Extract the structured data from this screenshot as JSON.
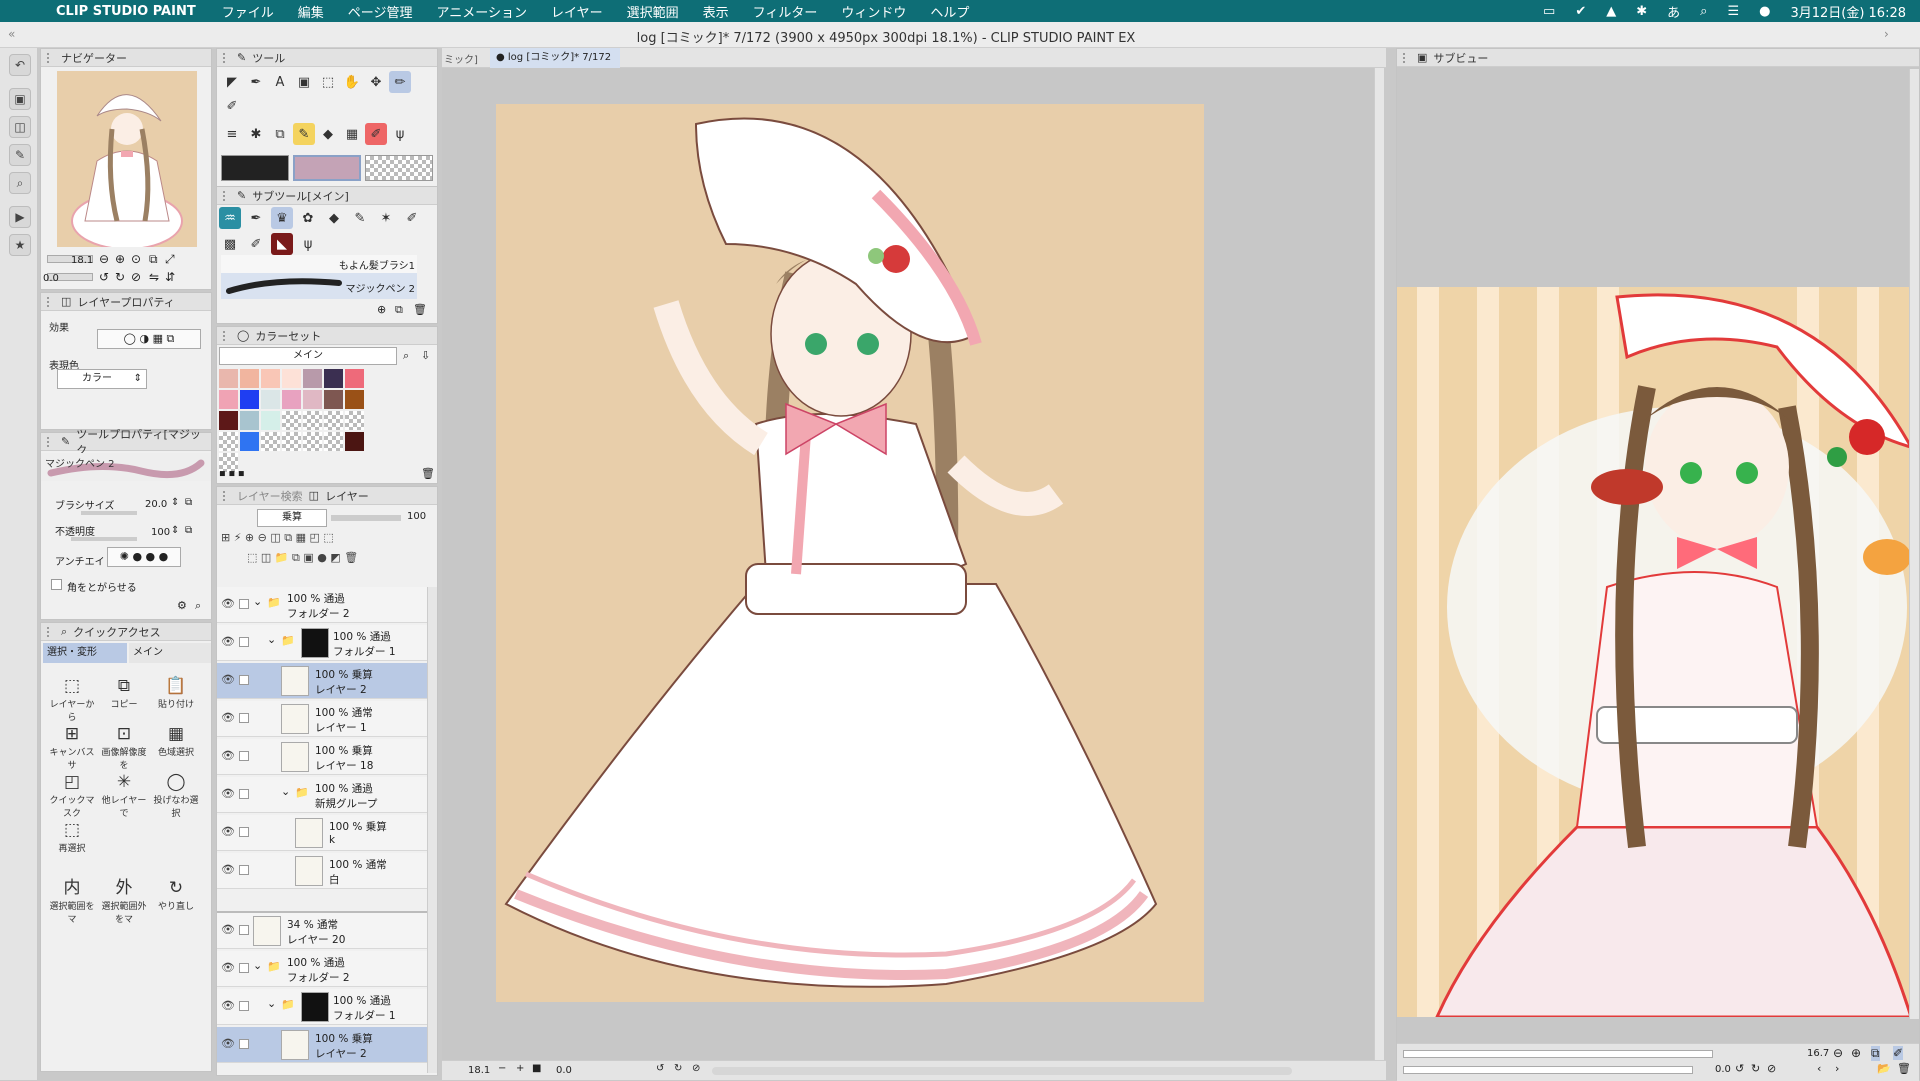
{
  "menubar": {
    "apple": "",
    "app_name": "CLIP STUDIO PAINT",
    "items": [
      "ファイル",
      "編集",
      "ページ管理",
      "アニメーション",
      "レイヤー",
      "選択範囲",
      "表示",
      "フィルター",
      "ウィンドウ",
      "ヘルプ"
    ],
    "datetime": "3月12日(金)  16:28"
  },
  "window": {
    "title": "log [コミック]* 7/172 (3900 x 4950px 300dpi 18.1%)  - CLIP STUDIO PAINT EX",
    "tab_prev": "ミック]",
    "tab_active": "● log [コミック]* 7/172"
  },
  "navigator": {
    "header": "ナビゲーター",
    "zoom": "18.1",
    "angle": "0.0"
  },
  "layer_property": {
    "header": "レイヤープロパティ",
    "effect_label": "効果",
    "expression_color_label": "表現色",
    "expression_color_value": "カラー"
  },
  "tool_property": {
    "header": "ツールプロパティ[マジック",
    "tool_name": "マジックペン 2",
    "brush_size_label": "ブラシサイズ",
    "brush_size_value": "20.0",
    "opacity_label": "不透明度",
    "opacity_value": "100",
    "antialias_label": "アンチエイ",
    "sharpen_corners_label": "角をとがらせる"
  },
  "quick_access": {
    "header": "クイックアクセス",
    "tab1": "選択・変形",
    "tab2": "メイン",
    "items": [
      {
        "label": "レイヤーから",
        "icon": "select-from-layer-icon",
        "glyph": "⬚"
      },
      {
        "label": "コピー",
        "icon": "copy-icon",
        "glyph": "⧉"
      },
      {
        "label": "貼り付け",
        "icon": "paste-icon",
        "glyph": "📋"
      },
      {
        "label": "キャンバスサ",
        "icon": "canvas-size-icon",
        "glyph": "⊞"
      },
      {
        "label": "画像解像度を",
        "icon": "resolution-icon",
        "glyph": "⊡"
      },
      {
        "label": "色域選択",
        "icon": "color-range-icon",
        "glyph": "▦"
      },
      {
        "label": "クイックマスク",
        "icon": "quick-mask-icon",
        "glyph": "◰"
      },
      {
        "label": "他レイヤーで",
        "icon": "other-layer-icon",
        "glyph": "✳"
      },
      {
        "label": "投げなわ選択",
        "icon": "lasso-icon",
        "glyph": "◯"
      },
      {
        "label": "再選択",
        "icon": "reselect-icon",
        "glyph": "⬚"
      },
      {
        "label": "選択範囲をマ",
        "icon": "inside-icon",
        "glyph": "内"
      },
      {
        "label": "選択範囲外をマ",
        "icon": "outside-icon",
        "glyph": "外"
      },
      {
        "label": "やり直し",
        "icon": "redo-icon",
        "glyph": "↻"
      }
    ]
  },
  "tool": {
    "header": "ツール"
  },
  "subtool": {
    "header": "サブツール[メイン]",
    "brush1": "もよん髪ブラシ1",
    "brush2": "マジックペン 2"
  },
  "colorset": {
    "header": "カラーセット",
    "set_name": "メイン",
    "colors": [
      "#e9b7ad",
      "#f1b59f",
      "#f9c6b6",
      "#fde1d7",
      "#b89aaa",
      "#3b2f51",
      "#ee6a7a",
      "#f0a3b4",
      "#1f3ef2",
      "#dbe6e7",
      "#e8a2c0",
      "#e0b8c4",
      "#7e5751",
      "#9a5117",
      "#5d1818",
      "#a8c4cf",
      "#d5efe9",
      "checker",
      "checker",
      "checker",
      "checker",
      "checker",
      "#2f74f2",
      "checker",
      "checker",
      "checker",
      "checker",
      "#4b1512",
      "checker"
    ]
  },
  "layers": {
    "search_tab": "レイヤー検索",
    "layer_tab": "レイヤー",
    "blend_mode": "乗算",
    "opacity": "100",
    "rows": [
      {
        "l1": "100 % 通過",
        "l2": "フォルダー 2",
        "indent": 0,
        "type": "folder",
        "sel": false
      },
      {
        "l1": "100 % 通過",
        "l2": "フォルダー 1",
        "indent": 1,
        "type": "folder-mask",
        "sel": false
      },
      {
        "l1": "100 % 乗算",
        "l2": "レイヤー 2",
        "indent": 2,
        "type": "layer",
        "sel": true
      },
      {
        "l1": "100 % 通常",
        "l2": "レイヤー 1",
        "indent": 2,
        "type": "layer",
        "sel": false
      },
      {
        "l1": "100 % 乗算",
        "l2": "レイヤー 18",
        "indent": 2,
        "type": "layer",
        "sel": false
      },
      {
        "l1": "100 % 通過",
        "l2": "新規グループ",
        "indent": 2,
        "type": "folder",
        "sel": false
      },
      {
        "l1": "100 % 乗算",
        "l2": "k",
        "indent": 3,
        "type": "layer",
        "sel": false
      },
      {
        "l1": "100 % 通常",
        "l2": "白",
        "indent": 3,
        "type": "layer",
        "sel": false
      }
    ],
    "rows2": [
      {
        "l1": "34 % 通常",
        "l2": "レイヤー 20",
        "indent": 0,
        "type": "layer",
        "sel": false
      },
      {
        "l1": "100 % 通過",
        "l2": "フォルダー 2",
        "indent": 0,
        "type": "folder",
        "sel": false
      },
      {
        "l1": "100 % 通過",
        "l2": "フォルダー 1",
        "indent": 1,
        "type": "folder-mask",
        "sel": false
      },
      {
        "l1": "100 % 乗算",
        "l2": "レイヤー 2",
        "indent": 2,
        "type": "layer",
        "sel": true
      }
    ]
  },
  "canvas_status": {
    "zoom": "18.1",
    "angle": "0.0"
  },
  "subview": {
    "header": "サブビュー",
    "zoom": "16.7",
    "angle": "0.0"
  },
  "colors": {
    "menubar": "#0e6e76",
    "canvas_bg": "#e8ceaa",
    "selected_row": "#b9c9e4",
    "main_color": "#222222",
    "sub_color": "#c4a3b6"
  }
}
